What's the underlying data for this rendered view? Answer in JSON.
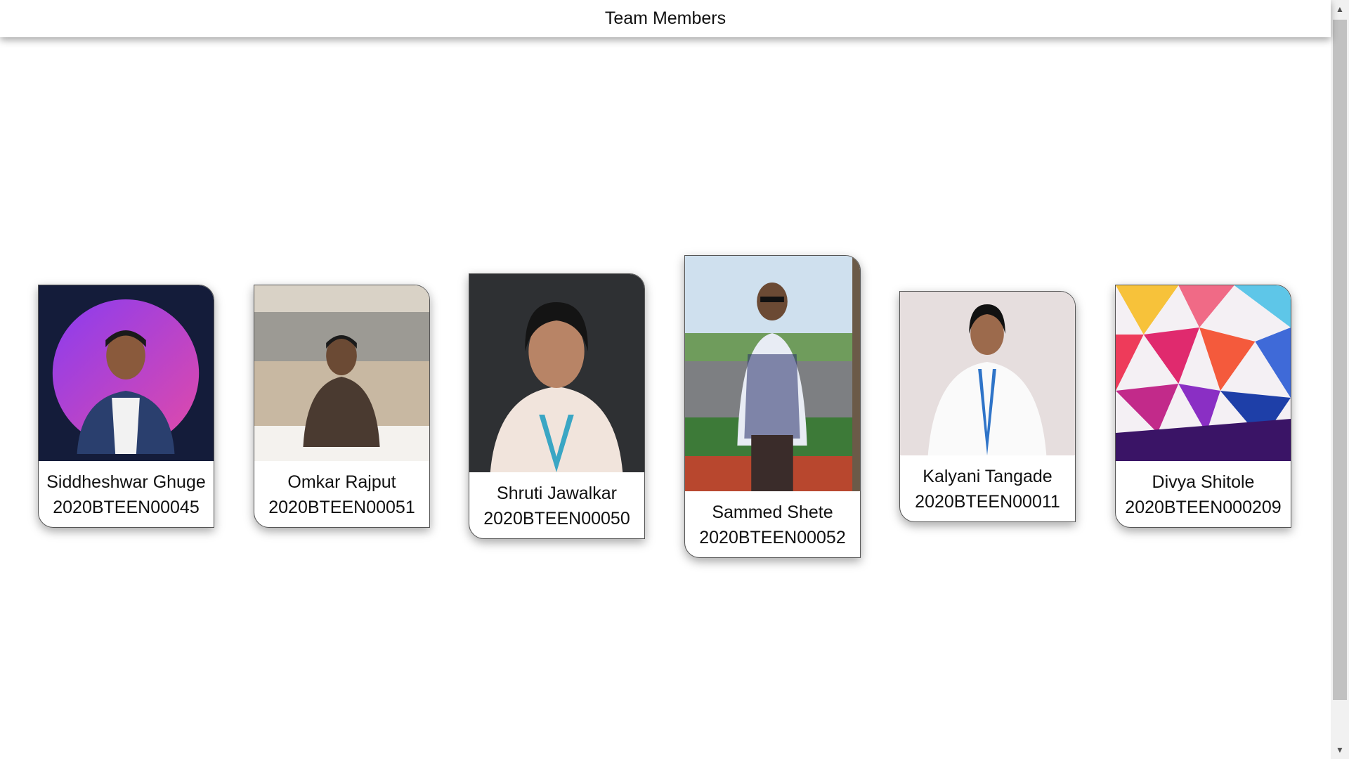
{
  "header": {
    "title": "Team Members"
  },
  "members": [
    {
      "name": "Siddheshwar Ghuge",
      "id": "2020BTEEN00045"
    },
    {
      "name": "Omkar Rajput",
      "id": "2020BTEEN00051"
    },
    {
      "name": "Shruti Jawalkar",
      "id": "2020BTEEN00050"
    },
    {
      "name": "Sammed Shete",
      "id": "2020BTEEN00052"
    },
    {
      "name": "Kalyani Tangade",
      "id": "2020BTEEN00011"
    },
    {
      "name": "Divya Shitole",
      "id": "2020BTEEN000209"
    }
  ],
  "scrollbar": {
    "up_icon": "▲",
    "down_icon": "▼"
  }
}
